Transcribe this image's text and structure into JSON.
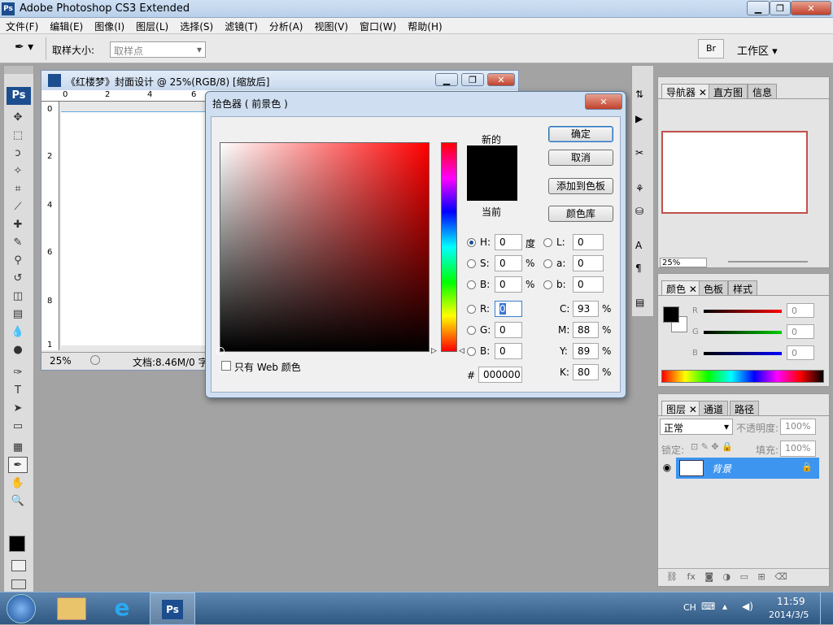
{
  "app": {
    "title": "Adobe Photoshop CS3 Extended",
    "logo": "Ps"
  },
  "menu": [
    "文件(F)",
    "编辑(E)",
    "图像(I)",
    "图层(L)",
    "选择(S)",
    "滤镜(T)",
    "分析(A)",
    "视图(V)",
    "窗口(W)",
    "帮助(H)"
  ],
  "options": {
    "sample_label": "取样大小:",
    "sample_value": "取样点",
    "workspace": "工作区 ▾"
  },
  "document": {
    "title": "《红楼梦》封面设计 @ 25%(RGB/8) [缩放后]",
    "ruler_h": [
      "0",
      "2",
      "4",
      "6"
    ],
    "ruler_v": [
      "0",
      "2",
      "4",
      "6",
      "8",
      "1"
    ],
    "zoom": "25%",
    "doc_info": "文档:8.46M/0 字节"
  },
  "picker": {
    "title": "拾色器 ( 前景色 )",
    "new_label": "新的",
    "current_label": "当前",
    "ok": "确定",
    "cancel": "取消",
    "add_swatch": "添加到色板",
    "libraries": "颜色库",
    "web_only": "只有 Web 颜色",
    "H": {
      "label": "H:",
      "value": "0",
      "unit": "度"
    },
    "S": {
      "label": "S:",
      "value": "0",
      "unit": "%"
    },
    "Bv": {
      "label": "B:",
      "value": "0",
      "unit": "%"
    },
    "R": {
      "label": "R:",
      "value": "0"
    },
    "G": {
      "label": "G:",
      "value": "0"
    },
    "Bb": {
      "label": "B:",
      "value": "0"
    },
    "L": {
      "label": "L:",
      "value": "0"
    },
    "a": {
      "label": "a:",
      "value": "0"
    },
    "b": {
      "label": "b:",
      "value": "0"
    },
    "C": {
      "label": "C:",
      "value": "93",
      "unit": "%"
    },
    "M": {
      "label": "M:",
      "value": "88",
      "unit": "%"
    },
    "Y": {
      "label": "Y:",
      "value": "89",
      "unit": "%"
    },
    "K": {
      "label": "K:",
      "value": "80",
      "unit": "%"
    },
    "hex_label": "#",
    "hex": "000000",
    "new_color": "#000000",
    "current_color": "#000000"
  },
  "navigator": {
    "tabs": [
      "导航器",
      "直方图",
      "信息"
    ],
    "zoom": "25%"
  },
  "color_panel": {
    "tabs": [
      "颜色",
      "色板",
      "样式"
    ],
    "R": "0",
    "G": "0",
    "B": "0",
    "r_label": "R",
    "g_label": "G",
    "b_label": "B"
  },
  "layers": {
    "tabs": [
      "图层",
      "通道",
      "路径"
    ],
    "blend": "正常",
    "opacity_label": "不透明度:",
    "opacity": "100%",
    "lock_label": "锁定:",
    "fill_label": "填充:",
    "fill": "100%",
    "layer_name": "背景"
  },
  "taskbar": {
    "lang": "CH",
    "time": "11:59",
    "date": "2014/3/5",
    "ps": "Ps"
  }
}
